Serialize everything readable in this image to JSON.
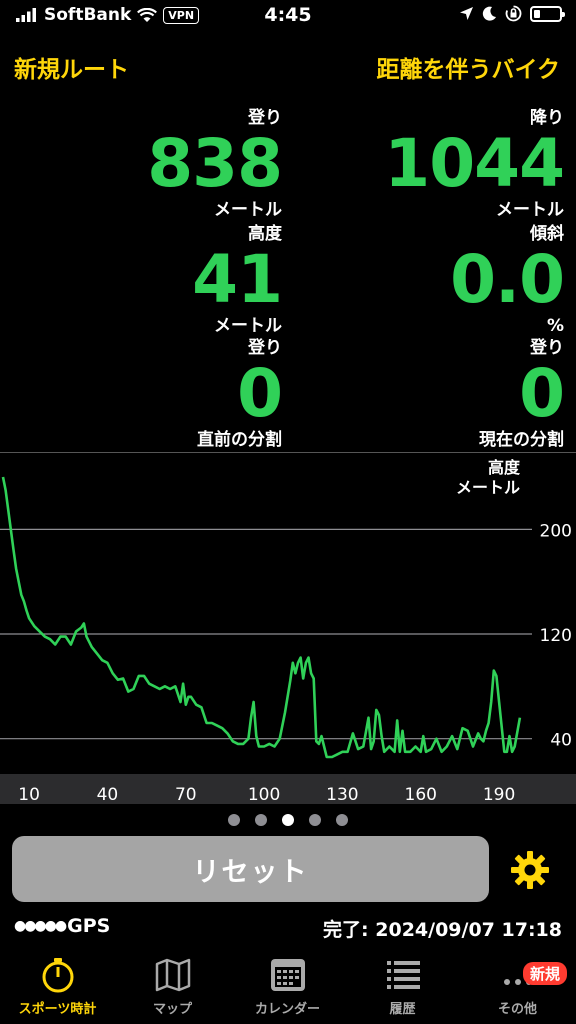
{
  "status_bar": {
    "carrier": "SoftBank",
    "vpn": "VPN",
    "time": "4:45"
  },
  "header": {
    "left_title": "新規ルート",
    "right_title": "距離を伴うバイク"
  },
  "metrics": [
    {
      "label": "登り",
      "value": "838",
      "unit": "メートル"
    },
    {
      "label": "降り",
      "value": "1044",
      "unit": "メートル"
    },
    {
      "label": "高度",
      "value": "41",
      "unit": "メートル"
    },
    {
      "label": "傾斜",
      "value": "0.0",
      "unit": "%"
    },
    {
      "label": "登り",
      "value": "0",
      "unit": "直前の分割"
    },
    {
      "label": "登り",
      "value": "0",
      "unit": "現在の分割"
    }
  ],
  "chart_data": {
    "type": "line",
    "title": "",
    "ylabel": "高度",
    "yunit": "メートル",
    "xlabel": "",
    "xlim": [
      0,
      203
    ],
    "ylim": [
      13,
      253
    ],
    "yticks": [
      40,
      120,
      200
    ],
    "xticks": [
      10,
      40,
      70,
      100,
      130,
      160,
      190
    ],
    "grid": true,
    "line_color": "#30d158",
    "series": [
      {
        "x": [
          0,
          1,
          2,
          3,
          4,
          5,
          6,
          7,
          8,
          9,
          10,
          12,
          14,
          16,
          18,
          20,
          22,
          24,
          26,
          28,
          30,
          31,
          32,
          34,
          36,
          38,
          40,
          42,
          44,
          46,
          48,
          50,
          52,
          54,
          56,
          58,
          60,
          62,
          64,
          66,
          68,
          69,
          70,
          71,
          72,
          74,
          76,
          78,
          80,
          82,
          84,
          86,
          88,
          90,
          92,
          94,
          95,
          96,
          97,
          98,
          100,
          102,
          104,
          106,
          108,
          110,
          111,
          112,
          113,
          114,
          115,
          116,
          117,
          118,
          119,
          120,
          121,
          122,
          123,
          124,
          126,
          128,
          130,
          132,
          134,
          136,
          138,
          140,
          141,
          142,
          143,
          144,
          145,
          146,
          148,
          150,
          151,
          152,
          153,
          154,
          156,
          158,
          160,
          161,
          162,
          164,
          166,
          168,
          170,
          172,
          174,
          176,
          178,
          180,
          182,
          183,
          184,
          185,
          186,
          187,
          188,
          189,
          190,
          192,
          193,
          194,
          195,
          196,
          198
        ],
        "y": [
          240,
          230,
          215,
          200,
          185,
          170,
          160,
          150,
          145,
          138,
          132,
          126,
          122,
          118,
          116,
          112,
          118,
          118,
          112,
          122,
          125,
          128,
          118,
          110,
          105,
          100,
          98,
          90,
          85,
          86,
          76,
          78,
          88,
          88,
          82,
          80,
          78,
          80,
          78,
          80,
          68,
          82,
          66,
          72,
          72,
          66,
          64,
          52,
          52,
          50,
          48,
          44,
          38,
          36,
          36,
          40,
          56,
          68,
          42,
          34,
          34,
          36,
          34,
          40,
          60,
          84,
          98,
          90,
          98,
          102,
          86,
          98,
          102,
          90,
          86,
          38,
          36,
          42,
          34,
          26,
          26,
          28,
          30,
          30,
          44,
          32,
          34,
          56,
          32,
          38,
          62,
          58,
          42,
          30,
          34,
          30,
          54,
          30,
          46,
          30,
          30,
          34,
          30,
          42,
          30,
          32,
          40,
          30,
          34,
          42,
          32,
          48,
          46,
          34,
          44,
          40,
          38,
          46,
          52,
          68,
          92,
          88,
          68,
          30,
          30,
          42,
          30,
          34,
          56
        ]
      }
    ]
  },
  "pagination": {
    "count": 5,
    "active_index": 2
  },
  "reset_label": "リセット",
  "gps": {
    "dots": "●●●●●",
    "label": "GPS"
  },
  "completion": "完了: 2024/09/07 17:18",
  "tabs": [
    {
      "label": "スポーツ時計",
      "icon": "stopwatch-icon",
      "active": true
    },
    {
      "label": "マップ",
      "icon": "map-icon",
      "active": false
    },
    {
      "label": "カレンダー",
      "icon": "calendar-icon",
      "active": false
    },
    {
      "label": "履歴",
      "icon": "history-list-icon",
      "active": false
    },
    {
      "label": "その他",
      "icon": "more-icon",
      "active": false,
      "badge": "新規"
    }
  ],
  "colors": {
    "accent": "#ffd60a",
    "value_green": "#30d158",
    "badge_red": "#ff3b30",
    "reset_bg": "#a5a5a5",
    "axis_band": "#2c2c2e"
  }
}
